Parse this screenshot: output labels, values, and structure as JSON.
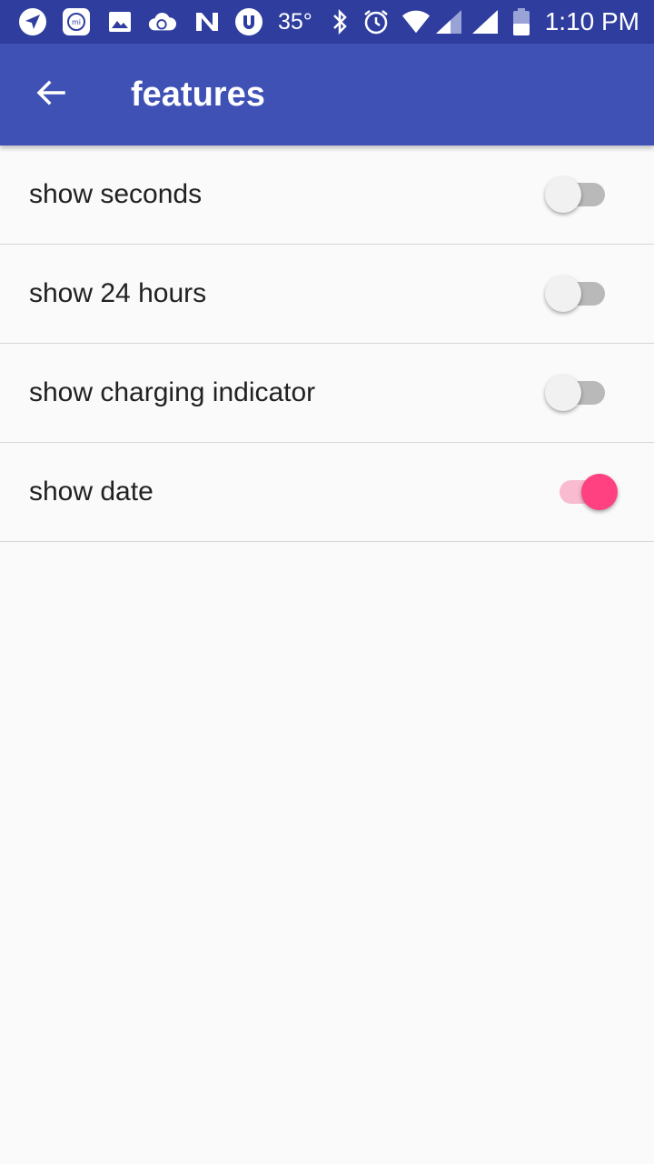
{
  "status_bar": {
    "temperature": "35°",
    "time": "1:10 PM",
    "icons": [
      "send-icon",
      "mi-icon",
      "image-icon",
      "cloud-sync-icon",
      "n-icon",
      "utorrent-icon",
      "bluetooth-icon",
      "alarm-icon",
      "wifi-icon",
      "signal-icon",
      "signal-icon-2",
      "battery-icon"
    ]
  },
  "app_bar": {
    "title": "features",
    "back_icon": "arrow-left-icon"
  },
  "settings": [
    {
      "label": "show seconds",
      "enabled": false
    },
    {
      "label": "show 24 hours",
      "enabled": false
    },
    {
      "label": "show charging indicator",
      "enabled": false
    },
    {
      "label": "show date",
      "enabled": true
    }
  ],
  "colors": {
    "status_bar": "#2f3e9e",
    "app_bar": "#3f51b5",
    "switch_on_thumb": "#ff4081",
    "switch_on_track": "#f8bbd0",
    "switch_off_thumb": "#f1f1f1",
    "switch_off_track": "#b9b9b9"
  }
}
